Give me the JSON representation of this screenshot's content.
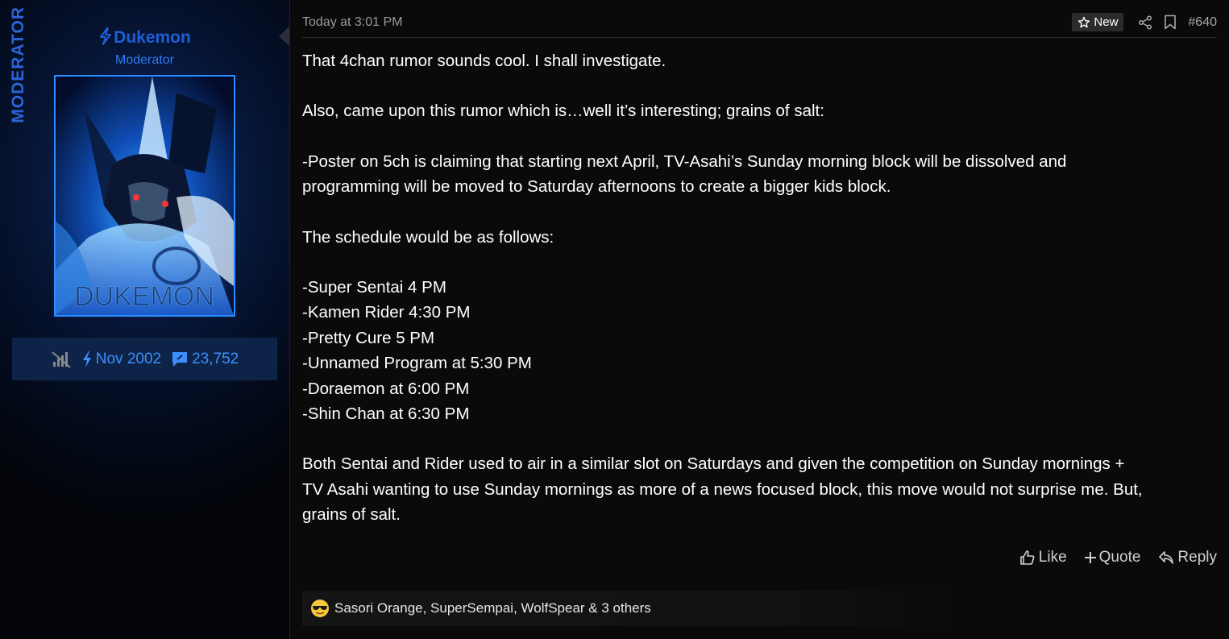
{
  "user": {
    "ribbon": "MODERATOR",
    "name": "Dukemon",
    "title": "Moderator",
    "avatar_text": "DUKEMON",
    "joined": "Nov 2002",
    "messages": "23,752",
    "icons": [
      "signal-off-icon",
      "bolt-icon",
      "message-icon"
    ]
  },
  "post": {
    "date": "Today at 3:01 PM",
    "new_label": "New",
    "number": "#640",
    "paragraphs": [
      "That 4chan rumor sounds cool. I shall investigate.",
      "Also, came upon this rumor which is…well it’s interesting; grains of salt:",
      "-Poster on 5ch is claiming that starting next April, TV-Asahi’s Sunday morning block will be dissolved and\nprogramming will be moved to Saturday afternoons to create a bigger kids block.",
      "The schedule would be as follows:",
      "-Super Sentai 4 PM\n-Kamen Rider 4:30 PM\n-Pretty Cure 5 PM\n-Unnamed Program at 5:30 PM\n-Doraemon at 6:00 PM\n-Shin Chan at 6:30 PM",
      "Both Sentai and Rider used to air in a similar slot on Saturdays and given the competition on Sunday mornings +\nTV Asahi wanting to use Sunday mornings as more of a news focused block, this move would not surprise me. But,\ngrains of salt."
    ],
    "actions": {
      "like": "Like",
      "quote": "Quote",
      "reply": "Reply"
    },
    "reactions": {
      "emoji": "cool-emoji",
      "text": "Sasori Orange, SuperSempai, WolfSpear & 3 others"
    }
  },
  "colors": {
    "accent": "#2f7cf6",
    "username": "#1e5ed8",
    "background": "#0a0a0a"
  }
}
